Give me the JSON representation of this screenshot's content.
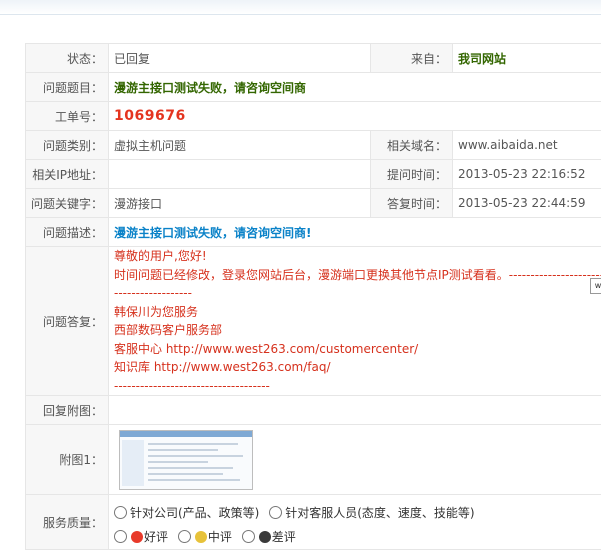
{
  "ticket": {
    "status_label": "状态：",
    "status_value": "已回复",
    "from_label": "来自：",
    "from_value": "我司网站",
    "title_label": "问题题目：",
    "title_value": "漫游主接口测试失败，请咨询空间商",
    "id_label": "工单号：",
    "id_value": "1069676",
    "category_label": "问题类别：",
    "category_value": "虚拟主机问题",
    "domain_label": "相关域名：",
    "domain_value": "www.aibaida.net",
    "ip_label": "相关IP地址：",
    "ip_value": "",
    "asked_label": "提问时间：",
    "asked_value": "2013-05-23 22:16:52",
    "keyword_label": "问题关键字：",
    "keyword_value": "漫游接口",
    "answered_label": "答复时间：",
    "answered_value": "2013-05-23 22:44:59",
    "desc_label": "问题描述：",
    "desc_value": "漫游主接口测试失败，请咨询空间商!",
    "answer_label": "问题答复：",
    "answer_lines": [
      "尊敬的用户,您好!",
      "时间问题已经修改，登录您网站后台，漫游端口更换其他节点IP测试看看。-------------------------------",
      "------------------",
      "韩保川为您服务",
      "西部数码客户服务部",
      "客服中心 http://www.west263.com/customercenter/",
      "知识库    http://www.west263.com/faq/",
      "------------------------------------"
    ],
    "reply_image_label": "回复附图：",
    "attach_label": "附图1：",
    "quality_label": "服务质量：",
    "quality_options": [
      "针对公司(产品、政策等)",
      "针对客服人员(态度、速度、技能等)"
    ],
    "rating_options": [
      "好评",
      "中评",
      "差评"
    ],
    "tip_text": "w"
  }
}
